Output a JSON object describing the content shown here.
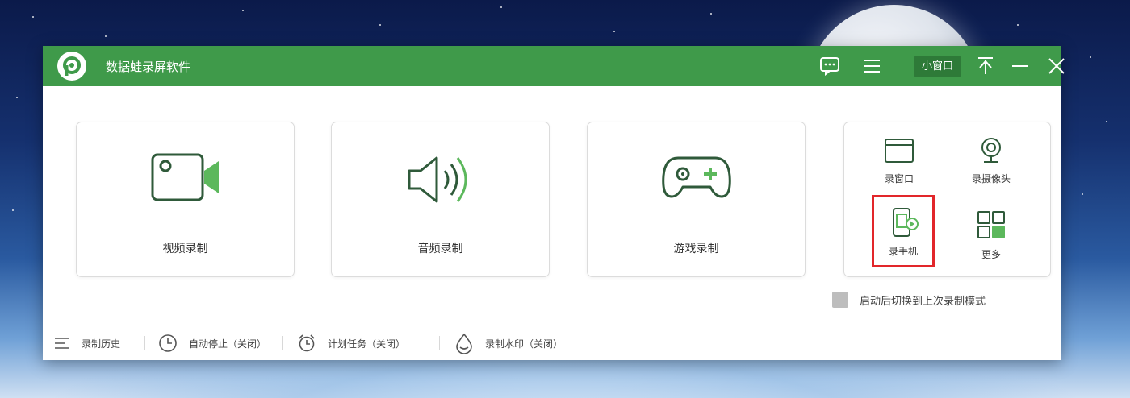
{
  "app": {
    "title": "数据蛙录屏软件",
    "accent_color": "#3f9a4a",
    "icons": [
      "feedback-icon",
      "menu-icon",
      "pin-icon",
      "minimize-icon",
      "close-icon"
    ]
  },
  "titlebar": {
    "mini_window_label": "小窗口"
  },
  "cards": [
    {
      "label": "视频录制",
      "icon": "video-camera-icon"
    },
    {
      "label": "音频录制",
      "icon": "speaker-icon"
    },
    {
      "label": "游戏录制",
      "icon": "gamepad-icon"
    }
  ],
  "side_panel": {
    "items": [
      {
        "label": "录窗口",
        "icon": "window-icon"
      },
      {
        "label": "录摄像头",
        "icon": "webcam-icon"
      },
      {
        "label": "录手机",
        "icon": "phone-record-icon",
        "highlighted": true
      },
      {
        "label": "更多",
        "icon": "grid-icon"
      }
    ],
    "highlight_color": "#e2262a"
  },
  "startup_option": {
    "label": "启动后切换到上次录制模式",
    "checked": false
  },
  "bottom_bar": {
    "items": [
      {
        "label": "录制历史",
        "icon": "list-icon"
      },
      {
        "label": "自动停止（关闭）",
        "icon": "clock-icon"
      },
      {
        "label": "计划任务（关闭）",
        "icon": "alarm-clock-icon"
      },
      {
        "label": "录制水印（关闭）",
        "icon": "watermark-drop-icon"
      }
    ]
  }
}
